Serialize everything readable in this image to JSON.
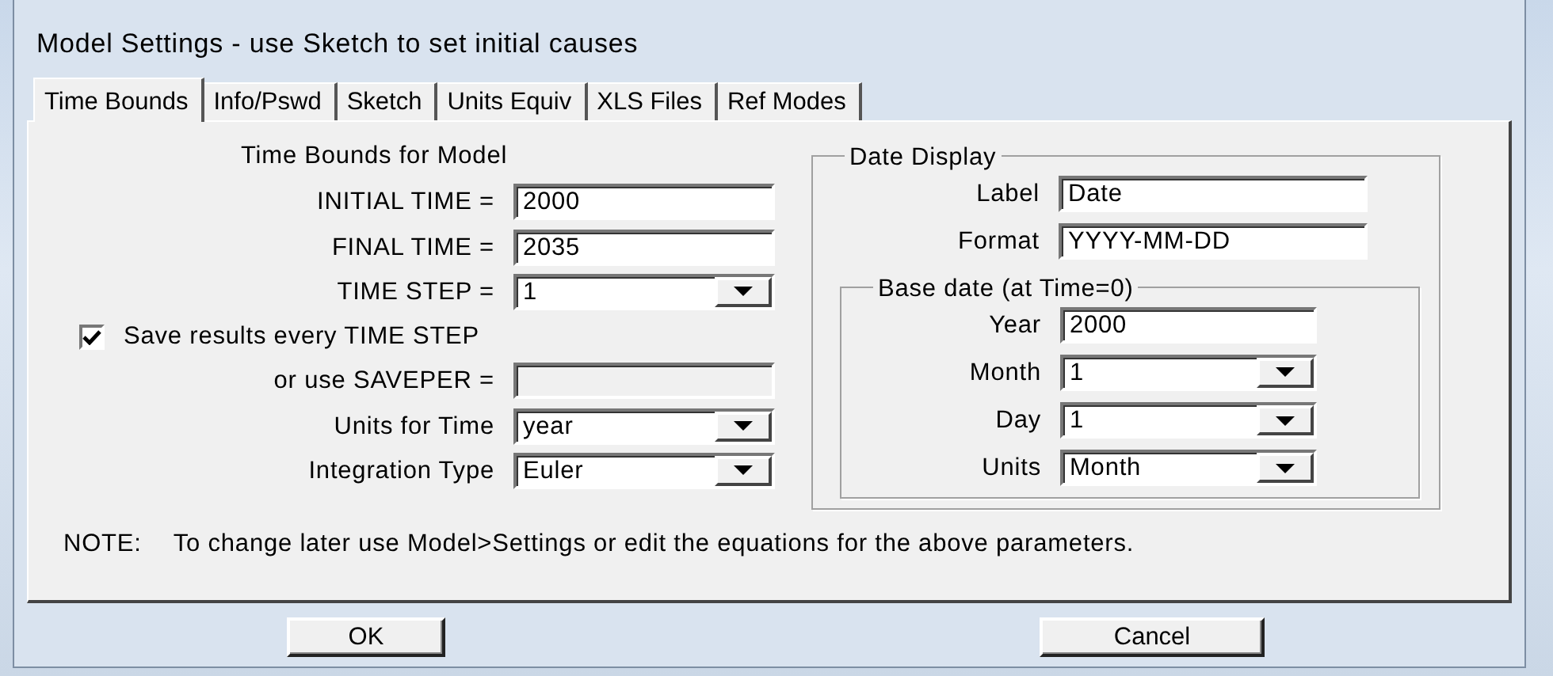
{
  "window": {
    "title": "Model Settings - use Sketch to set initial causes"
  },
  "tabs": [
    {
      "label": "Time Bounds",
      "selected": true
    },
    {
      "label": "Info/Pswd",
      "selected": false
    },
    {
      "label": "Sketch",
      "selected": false
    },
    {
      "label": "Units Equiv",
      "selected": false
    },
    {
      "label": "XLS Files",
      "selected": false
    },
    {
      "label": "Ref Modes",
      "selected": false
    }
  ],
  "time_bounds": {
    "heading": "Time Bounds for Model",
    "fields": [
      {
        "kind": "text",
        "label": "INITIAL TIME =",
        "value": "2000"
      },
      {
        "kind": "text",
        "label": "FINAL TIME =",
        "value": "2035"
      },
      {
        "kind": "dropdown",
        "label": "TIME STEP =",
        "value": "1"
      },
      {
        "kind": "checkbox",
        "label": "Save results every TIME STEP",
        "checked": true
      },
      {
        "kind": "text",
        "label": "or use SAVEPER =",
        "disabled": true
      },
      {
        "kind": "dropdown",
        "label": "Units for Time",
        "value": "year"
      },
      {
        "kind": "dropdown",
        "label": "Integration Type",
        "value": "Euler"
      }
    ]
  },
  "date_display": {
    "title": "Date Display",
    "fields": [
      {
        "kind": "text",
        "label": "Label",
        "value": "Date"
      },
      {
        "kind": "text",
        "label": "Format",
        "value": "YYYY-MM-DD"
      }
    ],
    "base_date": {
      "title": "Base date (at Time=0)",
      "fields": [
        {
          "kind": "text",
          "label": "Year",
          "value": "2000"
        },
        {
          "kind": "dropdown",
          "label": "Month",
          "value": "1"
        },
        {
          "kind": "dropdown",
          "label": "Day",
          "value": "1"
        },
        {
          "kind": "dropdown",
          "label": "Units",
          "value": "Month"
        }
      ]
    }
  },
  "note": {
    "label": "NOTE:",
    "text": "To change later use Model>Settings or edit the equations for the above parameters."
  },
  "buttons": [
    "OK",
    "Cancel"
  ]
}
